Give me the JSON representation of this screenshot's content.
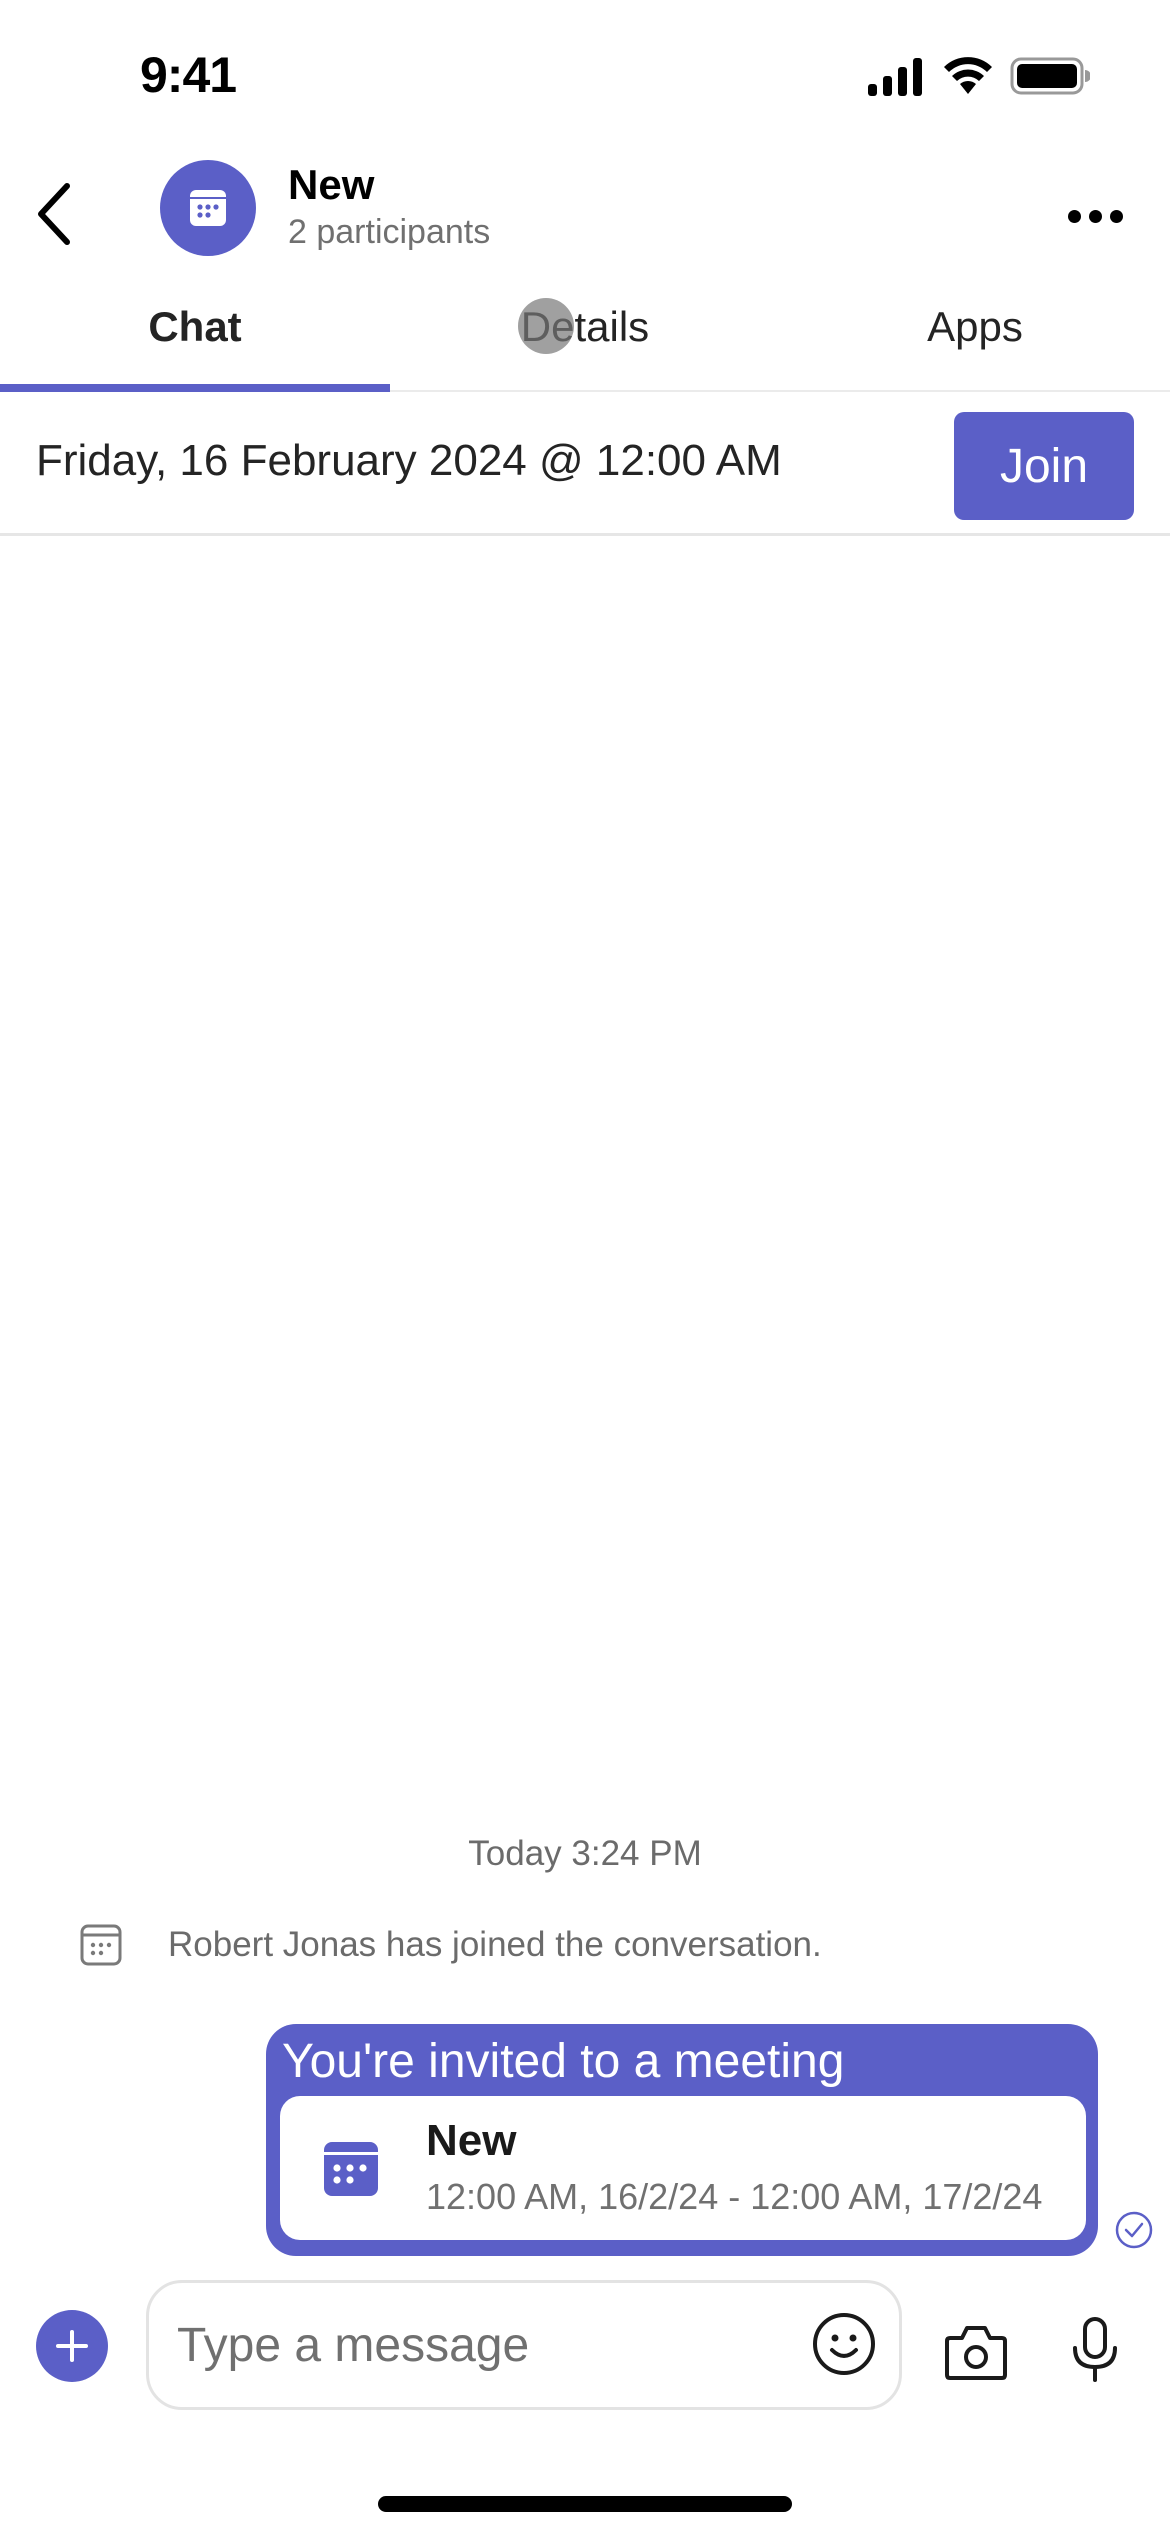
{
  "theme": {
    "accent": "#5b5fc7",
    "text": "#242424",
    "muted": "#707070"
  },
  "status_bar": {
    "time": "9:41"
  },
  "header": {
    "title": "New",
    "subtitle": "2 participants",
    "avatar_icon": "calendar-icon",
    "back_icon": "chevron-left-icon",
    "more_icon": "more-horizontal-icon"
  },
  "tabs": [
    {
      "label": "Chat",
      "active": true
    },
    {
      "label": "Details",
      "active": false
    },
    {
      "label": "Apps",
      "active": false
    }
  ],
  "meeting_banner": {
    "date_text": "Friday, 16 February 2024 @ 12:00 AM",
    "join_label": "Join"
  },
  "messages": {
    "timestamp": "Today 3:24 PM",
    "system_message": "Robert Jonas has joined the conversation.",
    "invite": {
      "title": "You're invited to a meeting",
      "meeting_name": "New",
      "meeting_time": "12:00 AM, 16/2/24 - 12:00 AM, 17/2/24",
      "status": "sent"
    }
  },
  "composer": {
    "placeholder": "Type a message",
    "value": ""
  }
}
